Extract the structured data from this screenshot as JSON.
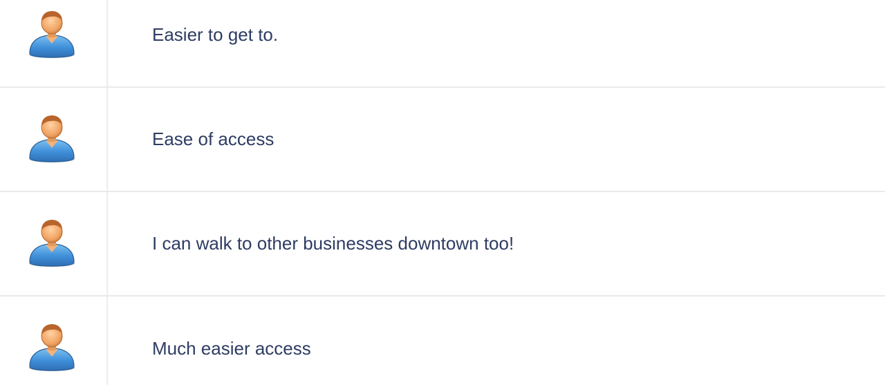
{
  "comments": [
    {
      "avatar_icon": "user-avatar-icon",
      "text": "Easier to get to."
    },
    {
      "avatar_icon": "user-avatar-icon",
      "text": "Ease of access"
    },
    {
      "avatar_icon": "user-avatar-icon",
      "text": "I can walk to other businesses downtown too!"
    },
    {
      "avatar_icon": "user-avatar-icon",
      "text": "Much easier access"
    }
  ],
  "colors": {
    "text": "#2e3c63",
    "divider": "#e9e9e9",
    "avatar_body": "#4a90d9",
    "avatar_head": "#e9a062"
  }
}
